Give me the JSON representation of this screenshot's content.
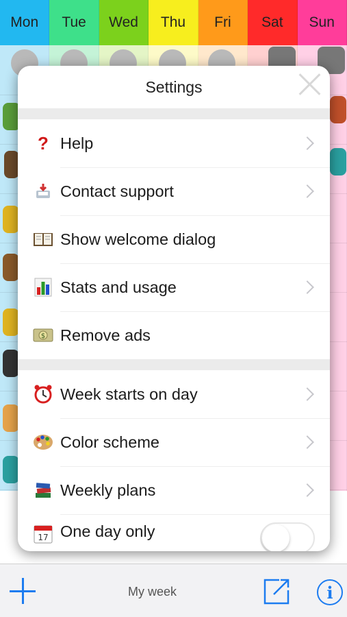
{
  "days": [
    {
      "label": "Mon",
      "color": "#22b8f0"
    },
    {
      "label": "Tue",
      "color": "#3ee08a"
    },
    {
      "label": "Wed",
      "color": "#7cd11c"
    },
    {
      "label": "Thu",
      "color": "#f7ee1e"
    },
    {
      "label": "Fri",
      "color": "#ff9a1a"
    },
    {
      "label": "Sat",
      "color": "#ff2a2a"
    },
    {
      "label": "Sun",
      "color": "#ff3d9a"
    }
  ],
  "column_colors": [
    "#bfe8f8",
    "#c4f3d7",
    "#e4f5c6",
    "#fdfac8",
    "#ffe8cc",
    "#ffd0d0",
    "#ffd0e6"
  ],
  "settings": {
    "title": "Settings",
    "section1": [
      {
        "label": "Help",
        "icon": "question-mark-icon",
        "chevron": true
      },
      {
        "label": "Contact support",
        "icon": "inbox-tray-icon",
        "chevron": true
      },
      {
        "label": "Show welcome dialog",
        "icon": "open-book-icon",
        "chevron": false
      },
      {
        "label": "Stats and usage",
        "icon": "bar-chart-icon",
        "chevron": true
      },
      {
        "label": "Remove ads",
        "icon": "dollar-banknote-icon",
        "chevron": false
      }
    ],
    "section2": [
      {
        "label": "Week starts on day",
        "icon": "alarm-clock-icon",
        "chevron": true
      },
      {
        "label": "Color scheme",
        "icon": "palette-icon",
        "chevron": true
      },
      {
        "label": "Weekly plans",
        "icon": "books-icon",
        "chevron": true
      },
      {
        "label": "One day only",
        "icon": "calendar-icon",
        "toggle": false
      }
    ]
  },
  "toolbar": {
    "title": "My week",
    "accent": "#1c7cf0"
  }
}
